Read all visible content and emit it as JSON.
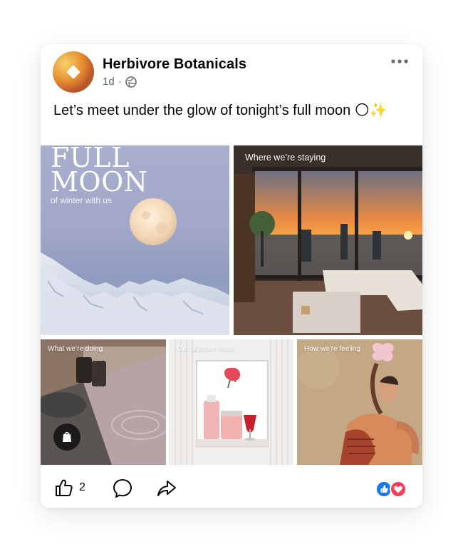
{
  "post": {
    "page_name": "Herbivore Botanicals",
    "time": "1d",
    "separator": "·",
    "caption": "Let’s meet under the glow of tonight’s full moon 🌕✨"
  },
  "tiles": {
    "t1": {
      "title_line1": "FULL",
      "title_line2": "MOON",
      "subtitle": "of winter with us"
    },
    "t2": {
      "label": "Where we’re staying"
    },
    "t3": {
      "label": "What we’re doing"
    },
    "t4": {
      "label": "Our skincare ritual"
    },
    "t5": {
      "label": "How we’re feeling"
    }
  },
  "footer": {
    "like_count": "2"
  },
  "icons": {
    "avatar": "brand-logo-icon",
    "more": "more-horizontal-icon",
    "audience": "globe-icon",
    "like": "thumbs-up-icon",
    "comment": "comment-icon",
    "share": "share-icon",
    "shop": "shopping-bag-icon",
    "reactions": [
      "like-reaction-icon",
      "love-reaction-icon"
    ]
  },
  "colors": {
    "like_blue": "#1877f2",
    "love_red": "#f33e58",
    "muted": "#65676b"
  }
}
